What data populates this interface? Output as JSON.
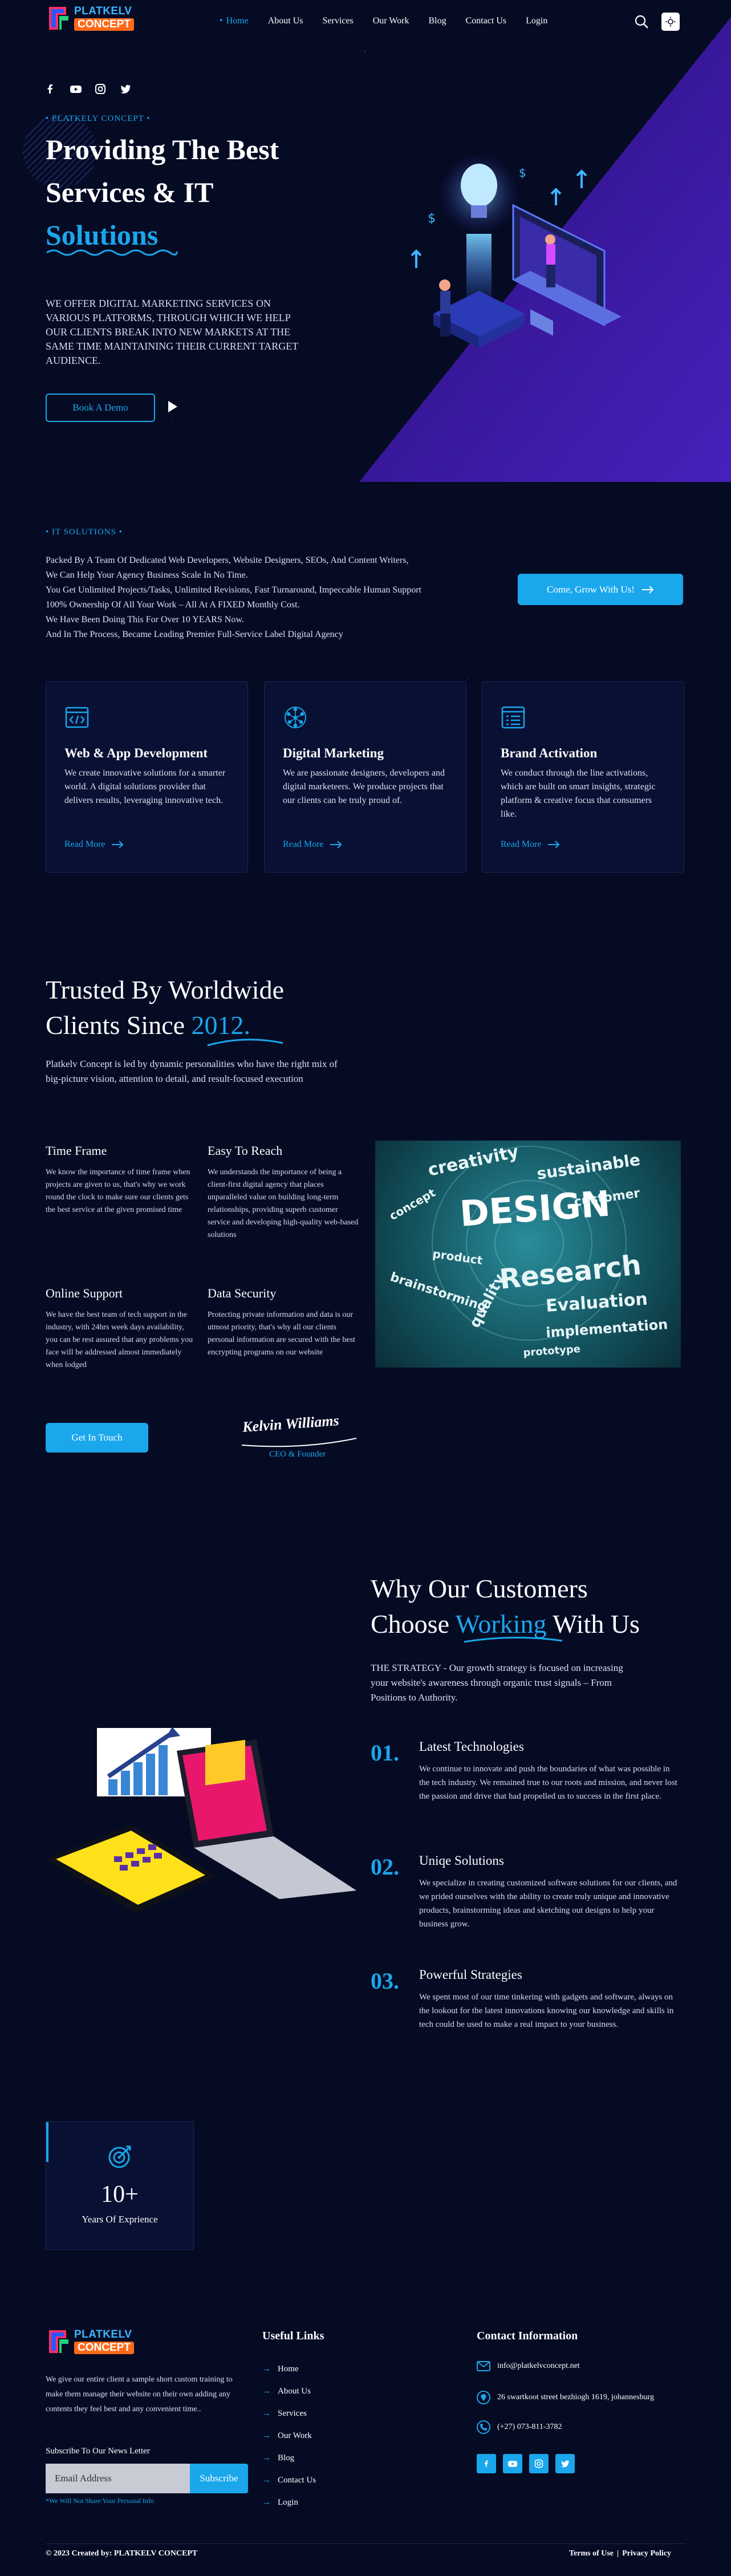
{
  "header": {
    "logo_line1": "PLATKELV",
    "logo_line2": "CONCEPT",
    "nav": [
      "Home",
      "About Us",
      "Services",
      "Our Work",
      "Blog",
      "Contact Us",
      "Login"
    ]
  },
  "hero": {
    "eyebrow": "• PLATKELY CONCEPT •",
    "title_line1": "Providing The Best",
    "title_line2": "Services & IT",
    "title_line3": "Solutions",
    "description": "We offer digital marketing services on various platforms, through which we help our clients break into new markets at the same time maintaining their current target audience.",
    "cta": "Book A Demo"
  },
  "it_solutions": {
    "eyebrow": "• IT SOLUTIONS •",
    "lines": [
      "Packed By A Team Of Dedicated Web Developers, Website Designers, SEOs, And Content Writers,",
      "We Can Help Your Agency Business Scale In No Time.",
      "You Get Unlimited Projects/Tasks, Unlimited Revisions, Fast Turnaround, Impeccable Human Support",
      "100% Ownership Of All Your Work – All At A FIXED Monthly Cost.",
      "We Have Been Doing This For Over 10 YEARS Now.",
      "And In The Process, Became Leading Premier Full-Service Label Digital Agency"
    ],
    "cta": "Come, Grow With Us!",
    "cards": [
      {
        "title": "Web & App Development",
        "text": "We create innovative solutions for a smarter world. A digital solutions provider that delivers results, leveraging innovative tech.",
        "more": "Read More"
      },
      {
        "title": "Digital Marketing",
        "text": "We are passionate designers, developers and digital marketeers. We produce projects that our clients can be truly proud of.",
        "more": "Read More"
      },
      {
        "title": "Brand Activation",
        "text": "We conduct through the line activations, which are built on smart insights, strategic platform & creative focus that consumers like.",
        "more": "Read More"
      }
    ]
  },
  "trusted": {
    "title_line1": "Trusted By Worldwide",
    "title_line2a": "Clients Since ",
    "title_year": "2012.",
    "intro": "Platkelv Concept is led by dynamic personalities who have the right mix of big-picture vision, attention to detail, and result-focused execution",
    "features": [
      {
        "title": "Time Frame",
        "text": "We know the importance of time frame when projects are given to us, that's why we work round the clock to make sure our clients gets the best service at the given promised time"
      },
      {
        "title": "Easy To Reach",
        "text": "We understands the importance of being a client-first digital agency that places unparalleled value on building long-term relationships, providing superb customer service and developing high-quality web-based solutions"
      },
      {
        "title": "Online Support",
        "text": "We have the best team of tech support in the industry, with 24hrs week days availability, you can be rest assured that any problems you face will be addressed almost immediately when lodged"
      },
      {
        "title": "Data Security",
        "text": "Protecting private information and data is our utmost priority, that's why all our clients personal information are secured with the best encrypting programs on our website"
      }
    ],
    "image_words": [
      "creativity",
      "sustainable",
      "DESIGN",
      "Research",
      "Evaluation",
      "brainstorming",
      "quality",
      "product",
      "concept",
      "implementation",
      "prototype",
      "customer"
    ],
    "cta": "Get In Touch",
    "signature": "Kelvin Williams",
    "signature_role": "CEO & Founder"
  },
  "why": {
    "title_line1": "Why Our Customers",
    "title_line2a": "Choose ",
    "title_highlight": "Working",
    "title_line2b": " With Us",
    "intro": "THE STRATEGY - Our growth strategy is focused on increasing your website's awareness through organic trust signals – From Positions to Authority.",
    "items": [
      {
        "num": "01.",
        "title": "Latest Technologies",
        "text": "We continue to innovate and push the boundaries of what was possible in the tech industry. We remained true to our roots and mission, and never lost the passion and drive that had propelled us to success in the first place."
      },
      {
        "num": "02.",
        "title": "Uniqe Solutions",
        "text": "We specialize in creating customized software solutions for our clients, and we prided ourselves with the ability to create truly unique and innovative products, brainstorming ideas and sketching out designs to help your business grow."
      },
      {
        "num": "03.",
        "title": "Powerful Strategies",
        "text": "We spent most of our time tinkering with gadgets and software, always on the lookout for the latest innovations knowing our knowledge and skills in tech could be used to make a real impact to your business."
      }
    ]
  },
  "experience": {
    "value": "10+",
    "label": "Years Of Exprience"
  },
  "footer": {
    "about": "We give our entire client a sample short custom training to make them manage their website on their own adding any contents they feel best and any convenient time..",
    "newsletter_label": "Subscribe To Our News Letter",
    "email_placeholder": "Email Address",
    "subscribe": "Subscribe",
    "privacy_note": "*We Will Not Share Your Personal Info",
    "useful_links_title": "Useful Links",
    "links": [
      "Home",
      "About Us",
      "Services",
      "Our Work",
      "Blog",
      "Contact Us",
      "Login"
    ],
    "contact_title": "Contact Information",
    "email": "info@platkelvconcept.net",
    "address": "26 swartkoot street bezhiogh 1619, johannesburg",
    "phone": "(+27) 073-811-3782",
    "copyright": "© 2023 Created by: PLATKELV CONCEPT",
    "terms": "Terms of Use",
    "privacy": "Privacy Policy"
  },
  "colors": {
    "accent": "#1aa7ec",
    "background": "#060b24",
    "purple": "#3b1a9e",
    "logo_orange": "#ff6a1a"
  }
}
